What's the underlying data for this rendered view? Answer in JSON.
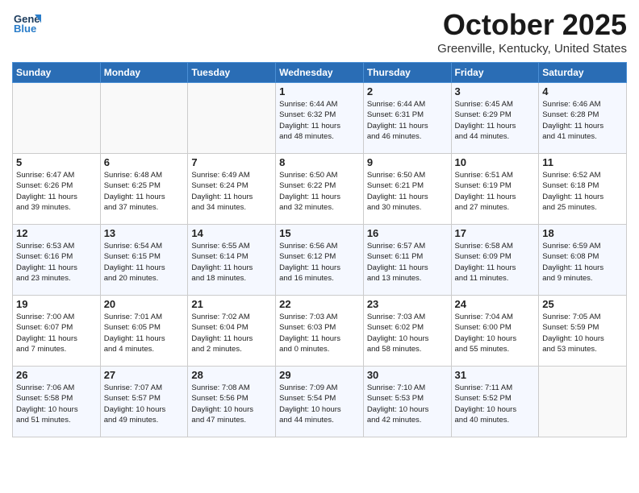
{
  "header": {
    "logo_line1": "General",
    "logo_line2": "Blue",
    "month_title": "October 2025",
    "location": "Greenville, Kentucky, United States"
  },
  "days_of_week": [
    "Sunday",
    "Monday",
    "Tuesday",
    "Wednesday",
    "Thursday",
    "Friday",
    "Saturday"
  ],
  "weeks": [
    [
      {
        "num": "",
        "info": ""
      },
      {
        "num": "",
        "info": ""
      },
      {
        "num": "",
        "info": ""
      },
      {
        "num": "1",
        "info": "Sunrise: 6:44 AM\nSunset: 6:32 PM\nDaylight: 11 hours\nand 48 minutes."
      },
      {
        "num": "2",
        "info": "Sunrise: 6:44 AM\nSunset: 6:31 PM\nDaylight: 11 hours\nand 46 minutes."
      },
      {
        "num": "3",
        "info": "Sunrise: 6:45 AM\nSunset: 6:29 PM\nDaylight: 11 hours\nand 44 minutes."
      },
      {
        "num": "4",
        "info": "Sunrise: 6:46 AM\nSunset: 6:28 PM\nDaylight: 11 hours\nand 41 minutes."
      }
    ],
    [
      {
        "num": "5",
        "info": "Sunrise: 6:47 AM\nSunset: 6:26 PM\nDaylight: 11 hours\nand 39 minutes."
      },
      {
        "num": "6",
        "info": "Sunrise: 6:48 AM\nSunset: 6:25 PM\nDaylight: 11 hours\nand 37 minutes."
      },
      {
        "num": "7",
        "info": "Sunrise: 6:49 AM\nSunset: 6:24 PM\nDaylight: 11 hours\nand 34 minutes."
      },
      {
        "num": "8",
        "info": "Sunrise: 6:50 AM\nSunset: 6:22 PM\nDaylight: 11 hours\nand 32 minutes."
      },
      {
        "num": "9",
        "info": "Sunrise: 6:50 AM\nSunset: 6:21 PM\nDaylight: 11 hours\nand 30 minutes."
      },
      {
        "num": "10",
        "info": "Sunrise: 6:51 AM\nSunset: 6:19 PM\nDaylight: 11 hours\nand 27 minutes."
      },
      {
        "num": "11",
        "info": "Sunrise: 6:52 AM\nSunset: 6:18 PM\nDaylight: 11 hours\nand 25 minutes."
      }
    ],
    [
      {
        "num": "12",
        "info": "Sunrise: 6:53 AM\nSunset: 6:16 PM\nDaylight: 11 hours\nand 23 minutes."
      },
      {
        "num": "13",
        "info": "Sunrise: 6:54 AM\nSunset: 6:15 PM\nDaylight: 11 hours\nand 20 minutes."
      },
      {
        "num": "14",
        "info": "Sunrise: 6:55 AM\nSunset: 6:14 PM\nDaylight: 11 hours\nand 18 minutes."
      },
      {
        "num": "15",
        "info": "Sunrise: 6:56 AM\nSunset: 6:12 PM\nDaylight: 11 hours\nand 16 minutes."
      },
      {
        "num": "16",
        "info": "Sunrise: 6:57 AM\nSunset: 6:11 PM\nDaylight: 11 hours\nand 13 minutes."
      },
      {
        "num": "17",
        "info": "Sunrise: 6:58 AM\nSunset: 6:09 PM\nDaylight: 11 hours\nand 11 minutes."
      },
      {
        "num": "18",
        "info": "Sunrise: 6:59 AM\nSunset: 6:08 PM\nDaylight: 11 hours\nand 9 minutes."
      }
    ],
    [
      {
        "num": "19",
        "info": "Sunrise: 7:00 AM\nSunset: 6:07 PM\nDaylight: 11 hours\nand 7 minutes."
      },
      {
        "num": "20",
        "info": "Sunrise: 7:01 AM\nSunset: 6:05 PM\nDaylight: 11 hours\nand 4 minutes."
      },
      {
        "num": "21",
        "info": "Sunrise: 7:02 AM\nSunset: 6:04 PM\nDaylight: 11 hours\nand 2 minutes."
      },
      {
        "num": "22",
        "info": "Sunrise: 7:03 AM\nSunset: 6:03 PM\nDaylight: 11 hours\nand 0 minutes."
      },
      {
        "num": "23",
        "info": "Sunrise: 7:03 AM\nSunset: 6:02 PM\nDaylight: 10 hours\nand 58 minutes."
      },
      {
        "num": "24",
        "info": "Sunrise: 7:04 AM\nSunset: 6:00 PM\nDaylight: 10 hours\nand 55 minutes."
      },
      {
        "num": "25",
        "info": "Sunrise: 7:05 AM\nSunset: 5:59 PM\nDaylight: 10 hours\nand 53 minutes."
      }
    ],
    [
      {
        "num": "26",
        "info": "Sunrise: 7:06 AM\nSunset: 5:58 PM\nDaylight: 10 hours\nand 51 minutes."
      },
      {
        "num": "27",
        "info": "Sunrise: 7:07 AM\nSunset: 5:57 PM\nDaylight: 10 hours\nand 49 minutes."
      },
      {
        "num": "28",
        "info": "Sunrise: 7:08 AM\nSunset: 5:56 PM\nDaylight: 10 hours\nand 47 minutes."
      },
      {
        "num": "29",
        "info": "Sunrise: 7:09 AM\nSunset: 5:54 PM\nDaylight: 10 hours\nand 44 minutes."
      },
      {
        "num": "30",
        "info": "Sunrise: 7:10 AM\nSunset: 5:53 PM\nDaylight: 10 hours\nand 42 minutes."
      },
      {
        "num": "31",
        "info": "Sunrise: 7:11 AM\nSunset: 5:52 PM\nDaylight: 10 hours\nand 40 minutes."
      },
      {
        "num": "",
        "info": ""
      }
    ]
  ]
}
